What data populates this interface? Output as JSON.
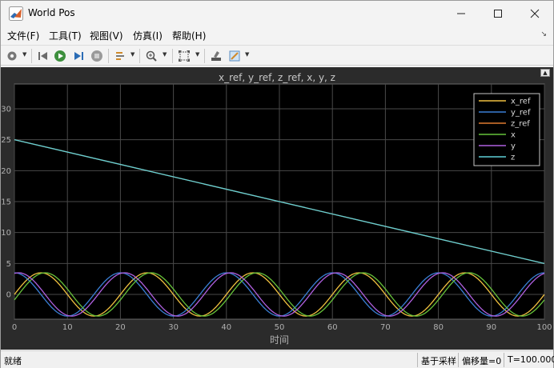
{
  "window": {
    "title": "World Pos"
  },
  "menu": {
    "items": [
      "文件(F)",
      "工具(T)",
      "视图(V)",
      "仿真(I)",
      "帮助(H)"
    ]
  },
  "toolbar": {
    "icons": [
      "gear-icon",
      "step-back-icon",
      "run-icon",
      "step-forward-icon",
      "stop-icon",
      "signal-select-icon",
      "zoom-icon",
      "fit-to-view-icon",
      "highlight-icon",
      "style-icon"
    ]
  },
  "chart_data": {
    "type": "line",
    "title": "x_ref, y_ref, z_ref, x, y, z",
    "xlabel": "时间",
    "ylabel": "",
    "xlim": [
      0,
      100
    ],
    "ylim": [
      -4,
      34
    ],
    "xticks": [
      "0",
      "10",
      "20",
      "30",
      "40",
      "50",
      "60",
      "70",
      "80",
      "90",
      "100"
    ],
    "yticks": [
      "0",
      "5",
      "10",
      "15",
      "20",
      "25",
      "30"
    ],
    "grid": true,
    "legend_position": "top-right",
    "series": [
      {
        "name": "x_ref",
        "color": "#f0c040",
        "function": "3.5*sin(2*pi*t/20)",
        "x": [
          0,
          5,
          10,
          15,
          20,
          25,
          30,
          35,
          40,
          45,
          50,
          55,
          60,
          65,
          70,
          75,
          80,
          85,
          90,
          95,
          100
        ],
        "values": [
          0,
          3.5,
          0,
          -3.5,
          0,
          3.5,
          0,
          -3.5,
          0,
          3.5,
          0,
          -3.5,
          0,
          3.5,
          0,
          -3.5,
          0,
          3.5,
          0,
          -3.5,
          0
        ]
      },
      {
        "name": "y_ref",
        "color": "#3a7fd5",
        "function": "3.5*cos(2*pi*t/20)",
        "x": [
          0,
          5,
          10,
          15,
          20,
          25,
          30,
          35,
          40,
          45,
          50,
          55,
          60,
          65,
          70,
          75,
          80,
          85,
          90,
          95,
          100
        ],
        "values": [
          3.5,
          0,
          -3.5,
          0,
          3.5,
          0,
          -3.5,
          0,
          3.5,
          0,
          -3.5,
          0,
          3.5,
          0,
          -3.5,
          0,
          3.5,
          0,
          -3.5,
          0,
          3.5
        ]
      },
      {
        "name": "z_ref",
        "color": "#e07a30",
        "x": [
          0,
          100
        ],
        "values": [
          25,
          5
        ]
      },
      {
        "name": "x",
        "color": "#66c23a",
        "function": "3.5*sin(2*pi*(t-0.8)/20)",
        "x": [
          0,
          5.8,
          10.8,
          15.8,
          20.8,
          25.8,
          30.8,
          35.8,
          40.8,
          45.8,
          50.8,
          55.8,
          60.8,
          65.8,
          70.8,
          75.8,
          80.8,
          85.8,
          90.8,
          95.8,
          100
        ],
        "values": [
          -0.9,
          3.5,
          0,
          -3.5,
          0,
          3.5,
          0,
          -3.5,
          0,
          3.5,
          0,
          -3.5,
          0,
          3.5,
          0,
          -3.5,
          0,
          3.5,
          0,
          -3.5,
          -0.9
        ]
      },
      {
        "name": "y",
        "color": "#b060e0",
        "function": "3.5*cos(2*pi*(t-0.8)/20)",
        "x": [
          0,
          0.8,
          5.8,
          10.8,
          15.8,
          20.8,
          25.8,
          30.8,
          35.8,
          40.8,
          45.8,
          50.8,
          55.8,
          60.8,
          65.8,
          70.8,
          75.8,
          80.8,
          85.8,
          90.8,
          95.8,
          100
        ],
        "values": [
          3.4,
          3.5,
          0,
          -3.5,
          0,
          3.5,
          0,
          -3.5,
          0,
          3.5,
          0,
          -3.5,
          0,
          3.5,
          0,
          -3.5,
          0,
          3.5,
          0,
          -3.5,
          0,
          3.4
        ]
      },
      {
        "name": "z",
        "color": "#5fd0d8",
        "x": [
          0,
          100
        ],
        "values": [
          25,
          5
        ]
      }
    ]
  },
  "status": {
    "left": "就绪",
    "sample_mode": "基于采样",
    "offset": "偏移量=0",
    "time": "T=100.000"
  },
  "colors": {
    "plot_bg": "#000000",
    "figure_bg": "#2b2b2b",
    "grid": "#4a4a4a",
    "axis_text": "#b0b0b0"
  }
}
